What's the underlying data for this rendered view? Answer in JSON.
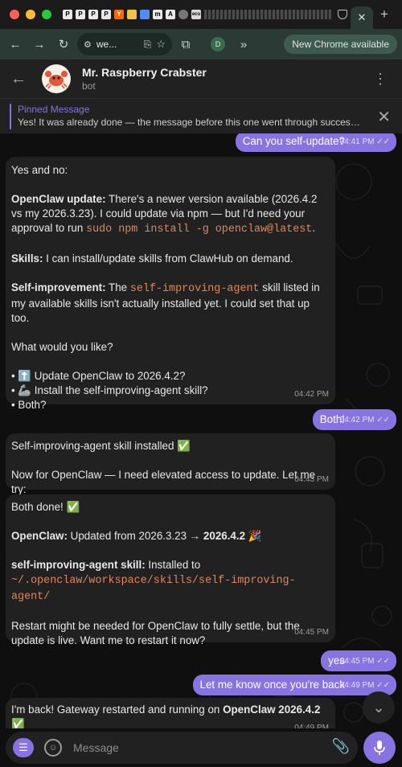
{
  "browser": {
    "tab_title": "we...",
    "new_chrome": "New Chrome available",
    "profile": "D",
    "favicons": [
      "P",
      "P",
      "P",
      "P",
      "Y",
      "",
      "",
      "m",
      "A",
      "",
      "ecu"
    ]
  },
  "chat": {
    "name": "Mr. Raspberry Crabster",
    "subtitle": "bot"
  },
  "pinned": {
    "label": "Pinned Message",
    "text": "Yes! It was already done — the message before this one went through successfu..."
  },
  "messages": {
    "m1": {
      "text": "Can you self-update?",
      "time": "04:41 PM"
    },
    "m2": {
      "p1": "Yes and no:",
      "p2_label": "OpenClaw update:",
      "p2_text": " There's a newer version available (2026.4.2 vs my 2026.3.23). I could update via npm — but I'd need your approval to run ",
      "p2_code": "sudo npm install -g openclaw@latest",
      "p2_end": ".",
      "p3_label": "Skills:",
      "p3_text": " I can install/update skills from ClawHub on demand.",
      "p4_label": "Self-improvement:",
      "p4_pre": " The ",
      "p4_code": "self-improving-agent",
      "p4_text": " skill listed in my available skills isn't actually installed yet. I could set that up too.",
      "p5": "What would you like?",
      "b1": "• ⬆️ Update OpenClaw to 2026.4.2?",
      "b2": "• 🦾 Install the self-improving-agent skill?",
      "b3": "• Both?",
      "time": "04:42 PM"
    },
    "m3": {
      "text": "Both!",
      "time": "04:42 PM"
    },
    "m4": {
      "p1": "Self-improving-agent skill installed ✅",
      "p2": "Now for OpenClaw — I need elevated access to update. Let me try:",
      "time": "04:43 PM"
    },
    "m5": {
      "p1": "Both done! ✅",
      "p2_label": "OpenClaw:",
      "p2_text": " Updated from 2026.3.23 → ",
      "p2_bold": "2026.4.2",
      "p2_end": " 🎉",
      "p3_label": "self-improving-agent skill:",
      "p3_text": " Installed to ",
      "p3_code": "~/.openclaw/workspace/skills/self-improving-agent/",
      "p4": "Restart might be needed for OpenClaw to fully settle, but the update is live. Want me to restart it now?",
      "time": "04:45 PM"
    },
    "m6": {
      "text": "yes",
      "time": "04:45 PM"
    },
    "m7": {
      "text": "Let me know once you're back",
      "time": "04:49 PM"
    },
    "m8": {
      "text": "I'm back! Gateway restarted and running on ",
      "bold": "OpenClaw 2026.4.2",
      "line2": "✅",
      "time": "04:49 PM"
    }
  },
  "composer": {
    "placeholder": "Message"
  },
  "colors": {
    "accent": "#8774e1",
    "bubble_in": "#212121",
    "code": "#e0865a"
  },
  "icons": [
    "back-arrow-icon",
    "forward-arrow-icon",
    "reload-icon",
    "site-settings-icon",
    "install-icon",
    "star-icon",
    "extensions-icon",
    "more-icon",
    "close-icon",
    "kebab-icon",
    "read-check-icon",
    "scroll-down-icon",
    "menu-icon",
    "emoji-icon",
    "attach-icon",
    "microphone-icon"
  ]
}
